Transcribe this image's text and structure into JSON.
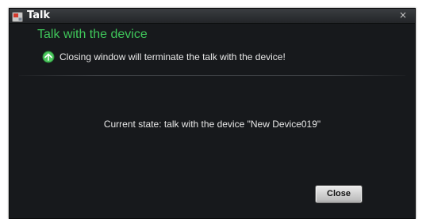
{
  "window": {
    "title": "Talk",
    "close_glyph": "×",
    "icon": "talk-app-icon"
  },
  "content": {
    "heading": "Talk with the device",
    "notice_icon": "info-icon",
    "notice": "Closing window will terminate the talk with the device!",
    "state": "Current state: talk with the device \"New Device019\""
  },
  "buttons": {
    "close_label": "Close"
  },
  "colors": {
    "heading": "#3fc65a",
    "background": "#17191c",
    "notice_icon": "#4cc85e"
  }
}
